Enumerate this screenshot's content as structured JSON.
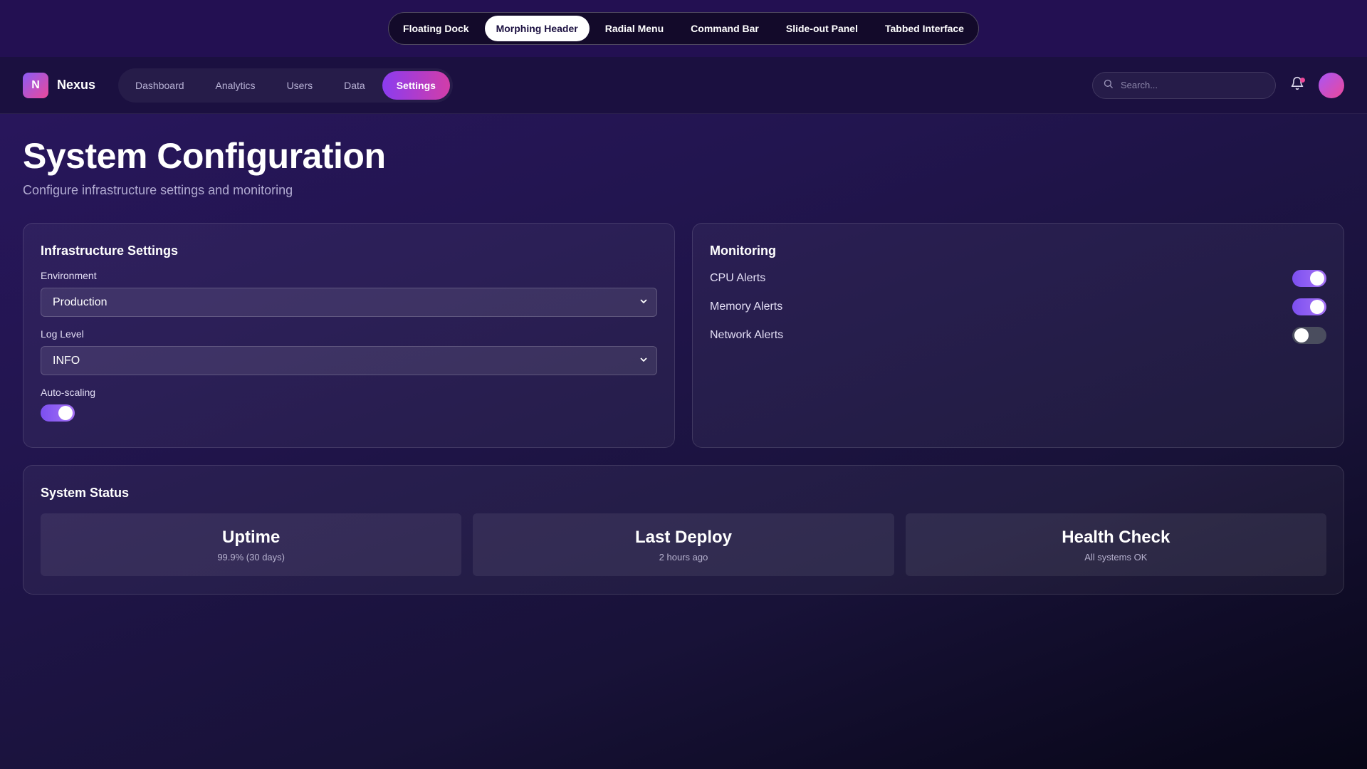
{
  "demo_tabs": [
    "Floating Dock",
    "Morphing Header",
    "Radial Menu",
    "Command Bar",
    "Slide-out Panel",
    "Tabbed Interface"
  ],
  "demo_active": "Morphing Header",
  "header": {
    "logo_letter": "N",
    "brand": "Nexus",
    "nav": [
      "Dashboard",
      "Analytics",
      "Users",
      "Data",
      "Settings"
    ],
    "nav_active": "Settings",
    "search_placeholder": "Search...",
    "notification_dot": true
  },
  "page": {
    "title": "System Configuration",
    "subtitle": "Configure infrastructure settings and monitoring"
  },
  "infrastructure": {
    "title": "Infrastructure Settings",
    "environment_label": "Environment",
    "environment_value": "Production",
    "log_level_label": "Log Level",
    "log_level_value": "INFO",
    "autoscaling_label": "Auto-scaling",
    "autoscaling_on": true
  },
  "monitoring": {
    "title": "Monitoring",
    "items": [
      {
        "label": "CPU Alerts",
        "on": true
      },
      {
        "label": "Memory Alerts",
        "on": true
      },
      {
        "label": "Network Alerts",
        "on": false
      }
    ]
  },
  "system_status": {
    "title": "System Status",
    "tiles": [
      {
        "name": "Uptime",
        "value": "99.9% (30 days)"
      },
      {
        "name": "Last Deploy",
        "value": "2 hours ago"
      },
      {
        "name": "Health Check",
        "value": "All systems OK"
      }
    ]
  },
  "colors": {
    "accent": "#8b5cf6",
    "accent_pink": "#ec4899",
    "toggle_off": "#4a4d5e"
  }
}
